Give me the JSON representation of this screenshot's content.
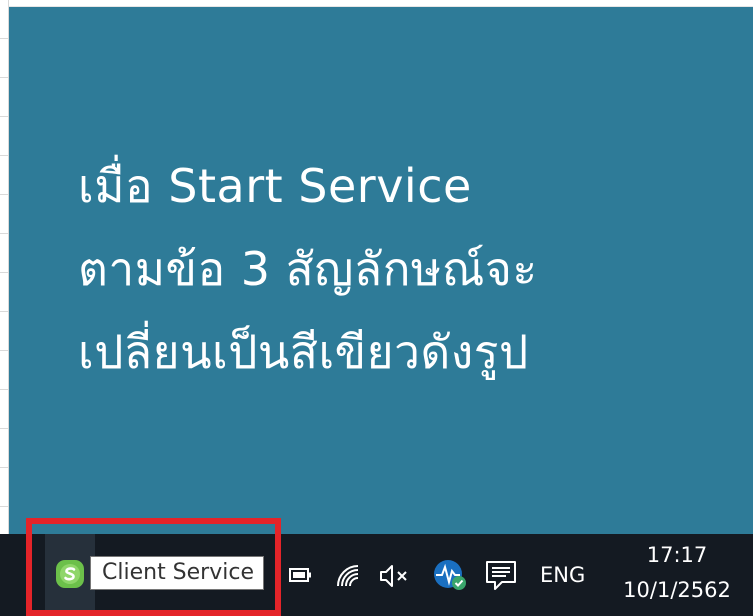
{
  "slide": {
    "caption_lines": [
      "เมื่อ Start Service",
      "ตามข้อ 3 สัญลักษณ์จะ",
      "เปลี่ยนเป็นสีเขียวดังรูป"
    ],
    "background": "#2e7b98"
  },
  "taskbar": {
    "tooltip": "Client Service",
    "language": "ENG",
    "time": "17:17",
    "date": "10/1/2562",
    "icons": [
      "client-service-icon",
      "battery-icon",
      "wifi-icon",
      "volume-muted-icon",
      "network-monitor-icon",
      "action-center-icon"
    ]
  },
  "colors": {
    "highlight": "#e42429",
    "client_service_status": "#6cc04a",
    "taskbar": "#141a22"
  }
}
